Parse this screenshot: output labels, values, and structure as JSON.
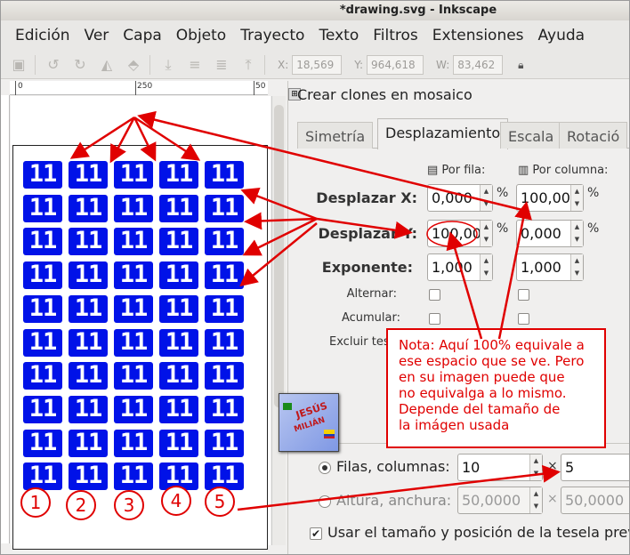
{
  "window": {
    "title": "*drawing.svg - Inkscape"
  },
  "menu": [
    "Edición",
    "Ver",
    "Capa",
    "Objeto",
    "Trayecto",
    "Texto",
    "Filtros",
    "Extensiones",
    "Ayuda"
  ],
  "toolbar": {
    "x_label": "X:",
    "x_value": "18,569",
    "y_label": "Y:",
    "y_value": "964,618",
    "w_label": "W:",
    "w_value": "83,462"
  },
  "ruler": {
    "mark_0": "0",
    "mark_250": "250",
    "mark_500": "50"
  },
  "tile_text": "11",
  "tile_colors": {
    "fill": "#0012e8",
    "text": "#ffffff"
  },
  "numbers": [
    "1",
    "2",
    "3",
    "4",
    "5"
  ],
  "dialog": {
    "title": "Crear clones en mosaico",
    "tabs": [
      "Simetría",
      "Desplazamiento",
      "Escala",
      "Rotació"
    ],
    "active_tab": "Desplazamiento",
    "col_header_row": "Por fila:",
    "col_header_col": "Por columna:",
    "rows": {
      "shift_x": {
        "label": "Desplazar X:",
        "row_value": "0,000",
        "col_value": "100,00",
        "unit": "%"
      },
      "shift_y": {
        "label": "Desplazar Y:",
        "row_value": "100,00",
        "col_value": "0,000",
        "unit": "%"
      },
      "exponent": {
        "label": "Exponente:",
        "row_value": "1,000",
        "col_value": "1,000"
      },
      "alternate": {
        "label": "Alternar:"
      },
      "cumulate": {
        "label": "Acumular:"
      },
      "exclude": {
        "label": "Excluir tese"
      }
    },
    "rows_cols": {
      "label": "Filas, columnas:",
      "rows": "10",
      "cols": "5",
      "times": "×"
    },
    "height_width": {
      "label": "Altura, anchura:",
      "height": "50,0000",
      "width": "50,0000"
    },
    "use_saved": {
      "label": "Usar el tamaño y posición de la tesela prev"
    }
  },
  "note": {
    "lines": [
      "Nota: Aquí 100% equivale a",
      "ese espacio que se ve. Pero",
      "en su imagen puede que",
      "no equivalga a lo mismo.",
      "Depende del tamaño de",
      "la imágen usada"
    ]
  },
  "logo": {
    "text": "JESÚS",
    "sub": "MILIÁN"
  },
  "annotation_color": "#e00000"
}
